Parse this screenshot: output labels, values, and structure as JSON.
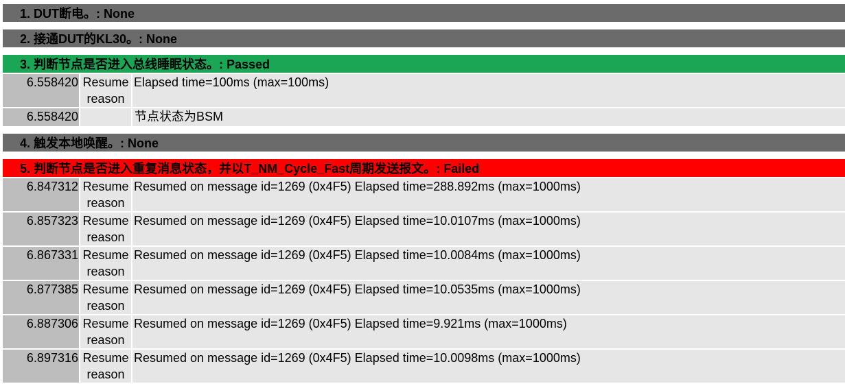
{
  "steps": [
    {
      "title": "1. DUT断电。: None",
      "status": "none",
      "rows": []
    },
    {
      "title": "2. 接通DUT的KL30。: None",
      "status": "none",
      "rows": []
    },
    {
      "title": "3. 判断节点是否进入总线睡眠状态。: Passed",
      "status": "passed",
      "rows": [
        {
          "time": "6.558420",
          "kind": "Resume reason",
          "message": "Elapsed time=100ms (max=100ms)"
        },
        {
          "time": "6.558420",
          "kind": "",
          "message": "节点状态为BSM"
        }
      ]
    },
    {
      "title": "4. 触发本地唤醒。: None",
      "status": "none",
      "rows": []
    },
    {
      "title": "5. 判断节点是否进入重复消息状态，并以T_NM_Cycle_Fast周期发送报文。: Failed",
      "status": "failed",
      "rows": [
        {
          "time": "6.847312",
          "kind": "Resume reason",
          "message": "Resumed on message id=1269 (0x4F5) Elapsed time=288.892ms (max=1000ms)"
        },
        {
          "time": "6.857323",
          "kind": "Resume reason",
          "message": "Resumed on message id=1269 (0x4F5) Elapsed time=10.0107ms (max=1000ms)"
        },
        {
          "time": "6.867331",
          "kind": "Resume reason",
          "message": "Resumed on message id=1269 (0x4F5) Elapsed time=10.0084ms (max=1000ms)"
        },
        {
          "time": "6.877385",
          "kind": "Resume reason",
          "message": "Resumed on message id=1269 (0x4F5) Elapsed time=10.0535ms (max=1000ms)"
        },
        {
          "time": "6.887306",
          "kind": "Resume reason",
          "message": "Resumed on message id=1269 (0x4F5) Elapsed time=9.921ms (max=1000ms)"
        },
        {
          "time": "6.897316",
          "kind": "Resume reason",
          "message": "Resumed on message id=1269 (0x4F5) Elapsed time=10.0098ms (max=1000ms)"
        }
      ]
    }
  ],
  "colors": {
    "none": "#6b6b6b",
    "passed": "#1aa655",
    "failed": "#ff0000",
    "timestamp_cell": "#bdbdbd",
    "body_cell": "#e6e6e6"
  }
}
